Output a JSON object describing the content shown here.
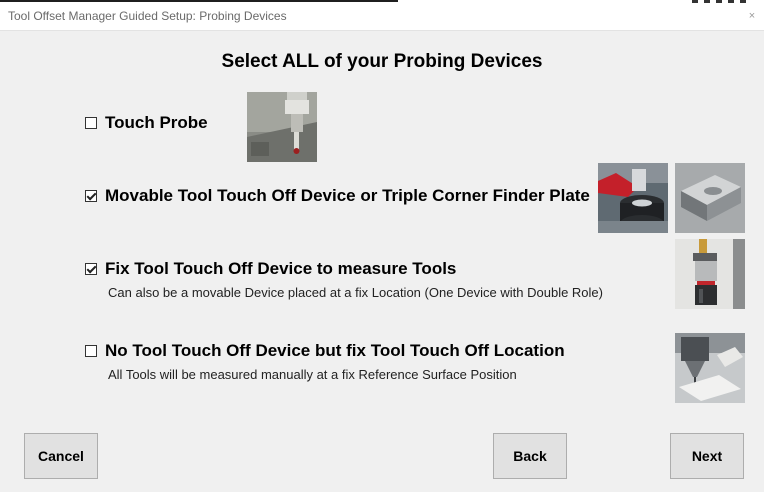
{
  "window": {
    "title": "Tool Offset Manager Guided Setup: Probing Devices",
    "close_glyph": "×"
  },
  "heading": "Select ALL of your Probing Devices",
  "options": [
    {
      "label": "Touch Probe",
      "checked": false,
      "description": "",
      "images": [
        "touch-probe-photo"
      ]
    },
    {
      "label": "Movable Tool Touch Off Device or Triple Corner Finder Plate",
      "checked": true,
      "description": "",
      "images": [
        "movable-touch-off-device-photo",
        "corner-finder-plate-photo"
      ]
    },
    {
      "label": "Fix Tool Touch Off Device to measure Tools",
      "checked": true,
      "description": "Can also be a movable Device placed at a fix Location (One Device with Double Role)",
      "images": [
        "fixed-tool-setter-photo"
      ]
    },
    {
      "label": "No Tool Touch Off Device but fix Tool Touch Off Location",
      "checked": false,
      "description": "All Tools will be measured manually at a fix Reference Surface Position",
      "images": [
        "reference-surface-photo"
      ]
    }
  ],
  "buttons": {
    "cancel": "Cancel",
    "back": "Back",
    "next": "Next"
  }
}
